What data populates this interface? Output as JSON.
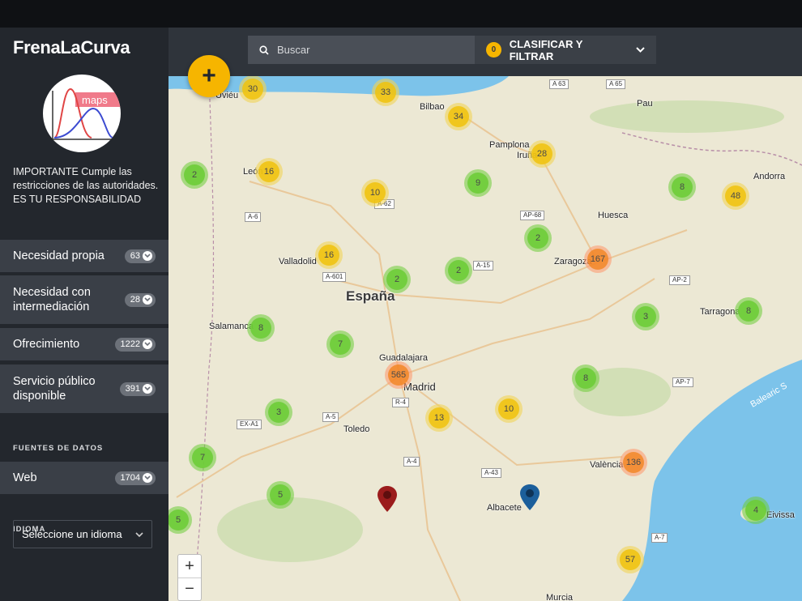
{
  "app": {
    "brand": "FrenaLaCurva",
    "logo_text": "maps"
  },
  "notice": "IMPORTANTE Cumple las restricciones de las autoridades. ES TU RESPONSABILIDAD",
  "menu": [
    {
      "label": "Necesidad propia",
      "count": "63"
    },
    {
      "label": "Necesidad con intermediación",
      "count": "28"
    },
    {
      "label": "Ofrecimiento",
      "count": "1222"
    },
    {
      "label": "Servicio público disponible",
      "count": "391"
    }
  ],
  "sources": {
    "title": "FUENTES DE DATOS",
    "items": [
      {
        "label": "Web",
        "count": "1704"
      }
    ]
  },
  "language": {
    "title": "IDIOMA",
    "placeholder": "Seleccione un idioma"
  },
  "search": {
    "placeholder": "Buscar"
  },
  "filter": {
    "count": "0",
    "label": "CLASIFICAR Y FILTRAR"
  },
  "add_button": "+",
  "zoom": {
    "in": "+",
    "out": "−"
  },
  "map": {
    "places": [
      "Uviéu",
      "Bilbao",
      "Pamplona",
      "Iruña",
      "León",
      "Andorra",
      "Huesca",
      "Valladolid",
      "Zaragoza",
      "España",
      "Salamanca",
      "Tarragona",
      "Guadalajara",
      "Madrid",
      "Toledo",
      "València",
      "Albacete",
      "Pau",
      "Balearic S",
      "Eivissa",
      "Murcia"
    ],
    "roads": [
      "A 63",
      "A 65",
      "A-6",
      "A-62",
      "AP-68",
      "A-15",
      "A-601",
      "AP-2",
      "R-4",
      "A-5",
      "EX-A1",
      "A-4",
      "A-43",
      "A-7",
      "AP-7"
    ],
    "clusters": [
      {
        "count": "30",
        "tier": "yellow"
      },
      {
        "count": "33",
        "tier": "yellow"
      },
      {
        "count": "34",
        "tier": "yellow"
      },
      {
        "count": "28",
        "tier": "yellow"
      },
      {
        "count": "2",
        "tier": "green"
      },
      {
        "count": "16",
        "tier": "yellow"
      },
      {
        "count": "10",
        "tier": "yellow"
      },
      {
        "count": "9",
        "tier": "green"
      },
      {
        "count": "8",
        "tier": "green"
      },
      {
        "count": "48",
        "tier": "yellow"
      },
      {
        "count": "2",
        "tier": "green"
      },
      {
        "count": "16",
        "tier": "yellow"
      },
      {
        "count": "2",
        "tier": "green"
      },
      {
        "count": "2",
        "tier": "green"
      },
      {
        "count": "167",
        "tier": "orange"
      },
      {
        "count": "8",
        "tier": "green"
      },
      {
        "count": "3",
        "tier": "green"
      },
      {
        "count": "8",
        "tier": "green"
      },
      {
        "count": "7",
        "tier": "green"
      },
      {
        "count": "565",
        "tier": "orange"
      },
      {
        "count": "8",
        "tier": "green"
      },
      {
        "count": "3",
        "tier": "green"
      },
      {
        "count": "13",
        "tier": "yellow"
      },
      {
        "count": "10",
        "tier": "yellow"
      },
      {
        "count": "7",
        "tier": "green"
      },
      {
        "count": "136",
        "tier": "orange"
      },
      {
        "count": "5",
        "tier": "green"
      },
      {
        "count": "5",
        "tier": "green"
      },
      {
        "count": "4",
        "tier": "green"
      },
      {
        "count": "57",
        "tier": "yellow"
      }
    ]
  },
  "colors": {
    "sidebar": "#23272d",
    "menu_item": "#3a3f47",
    "accent": "#f6b500",
    "sea": "#7cc3ea",
    "land": "#ece8d4",
    "marker_red": "#9b1c1c",
    "marker_blue": "#1c5f9b"
  }
}
